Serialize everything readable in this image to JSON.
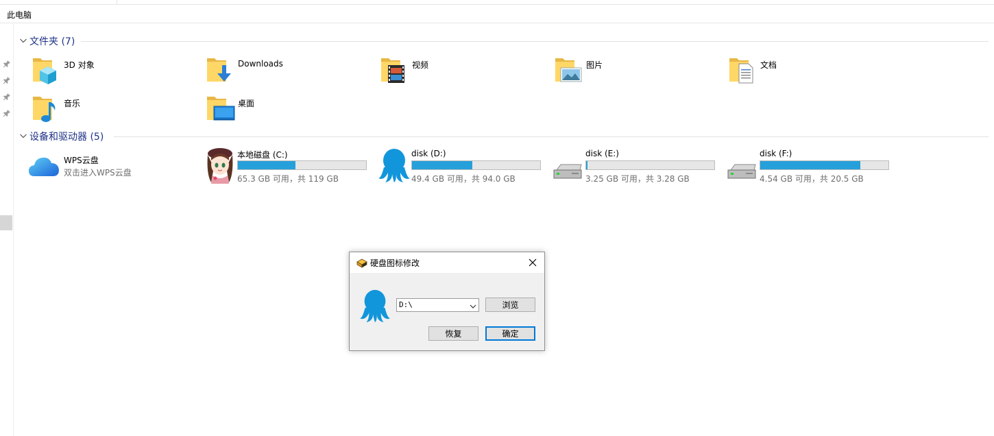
{
  "address": {
    "crumb": "此电脑"
  },
  "groups": {
    "folders": {
      "title": "文件夹 (7)"
    },
    "devices": {
      "title": "设备和驱动器 (5)"
    }
  },
  "folders": [
    {
      "name": "3D 对象",
      "icon": "folder-3d-objects-icon"
    },
    {
      "name": "Downloads",
      "icon": "folder-downloads-icon"
    },
    {
      "name": "视频",
      "icon": "folder-videos-icon"
    },
    {
      "name": "图片",
      "icon": "folder-pictures-icon"
    },
    {
      "name": "文档",
      "icon": "folder-documents-icon"
    },
    {
      "name": "音乐",
      "icon": "folder-music-icon"
    },
    {
      "name": "桌面",
      "icon": "folder-desktop-icon"
    }
  ],
  "cloud": {
    "name": "WPS云盘",
    "subtitle": "双击进入WPS云盘"
  },
  "drives": [
    {
      "name": "本地磁盘 (C:)",
      "free_text": "65.3 GB 可用，共 119 GB",
      "used_fraction": 0.45,
      "icon": "anime-girl-drive-icon"
    },
    {
      "name": "disk (D:)",
      "free_text": "49.4 GB 可用，共 94.0 GB",
      "used_fraction": 0.47,
      "icon": "octopus-drive-icon"
    },
    {
      "name": "disk (E:)",
      "free_text": "3.25 GB 可用，共 3.28 GB",
      "used_fraction": 0.01,
      "icon": "hard-drive-icon"
    },
    {
      "name": "disk (F:)",
      "free_text": "4.54 GB 可用，共 20.5 GB",
      "used_fraction": 0.78,
      "icon": "hard-drive-icon"
    }
  ],
  "dialog": {
    "title": "硬盘图标修改",
    "drive_value": "D:\\",
    "browse_label": "浏览",
    "restore_label": "恢复",
    "ok_label": "确定"
  },
  "colors": {
    "accent": "#0078d7",
    "usage_bar": "#26a0da",
    "group_title": "#1e3287"
  }
}
